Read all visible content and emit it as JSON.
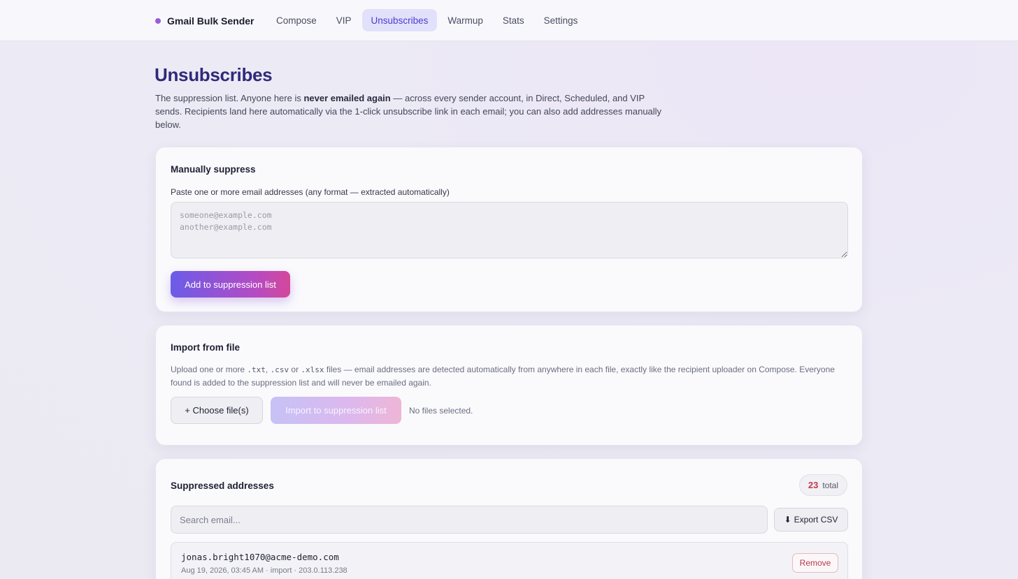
{
  "app": {
    "name": "Gmail Bulk Sender",
    "brand_color": "#9a5bd6"
  },
  "nav": {
    "items": [
      {
        "label": "Compose"
      },
      {
        "label": "VIP"
      },
      {
        "label": "Unsubscribes"
      },
      {
        "label": "Warmup"
      },
      {
        "label": "Stats"
      },
      {
        "label": "Settings"
      }
    ],
    "active": "Unsubscribes"
  },
  "page": {
    "title": "Unsubscribes",
    "desc_prefix": "The suppression list. Anyone here is ",
    "desc_bold": "never emailed again",
    "desc_suffix": " — across every sender account, in Direct, Scheduled, and VIP sends. Recipients land here automatically via the 1-click unsubscribe link in each email; you can also add addresses manually below."
  },
  "manual": {
    "title": "Manually suppress",
    "label": "Paste one or more email addresses (any format — extracted automatically)",
    "placeholder": "someone@example.com\nanother@example.com",
    "button": "Add to suppression list"
  },
  "import": {
    "title": "Import from file",
    "desc_1": "Upload one or more ",
    "ext_txt": ".txt",
    "desc_2": ", ",
    "ext_csv": ".csv",
    "desc_3": " or ",
    "ext_xlsx": ".xlsx",
    "desc_4": " files — email addresses are detected automatically from anywhere in each file, exactly like the recipient uploader on Compose. Everyone found is added to the suppression list and will never be emailed again.",
    "choose_button": "+ Choose file(s)",
    "import_button": "Import to suppression list",
    "status": "No files selected."
  },
  "list": {
    "title": "Suppressed addresses",
    "total_count": "23",
    "total_label": "total",
    "search_placeholder": "Search email...",
    "export_icon": "⬇",
    "export_label": "Export CSV",
    "rows": [
      {
        "email": "jonas.bright1070@acme-demo.com",
        "meta": "Aug 19, 2026, 03:45 AM · import · 203.0.113.238",
        "remove_label": "Remove"
      }
    ]
  }
}
